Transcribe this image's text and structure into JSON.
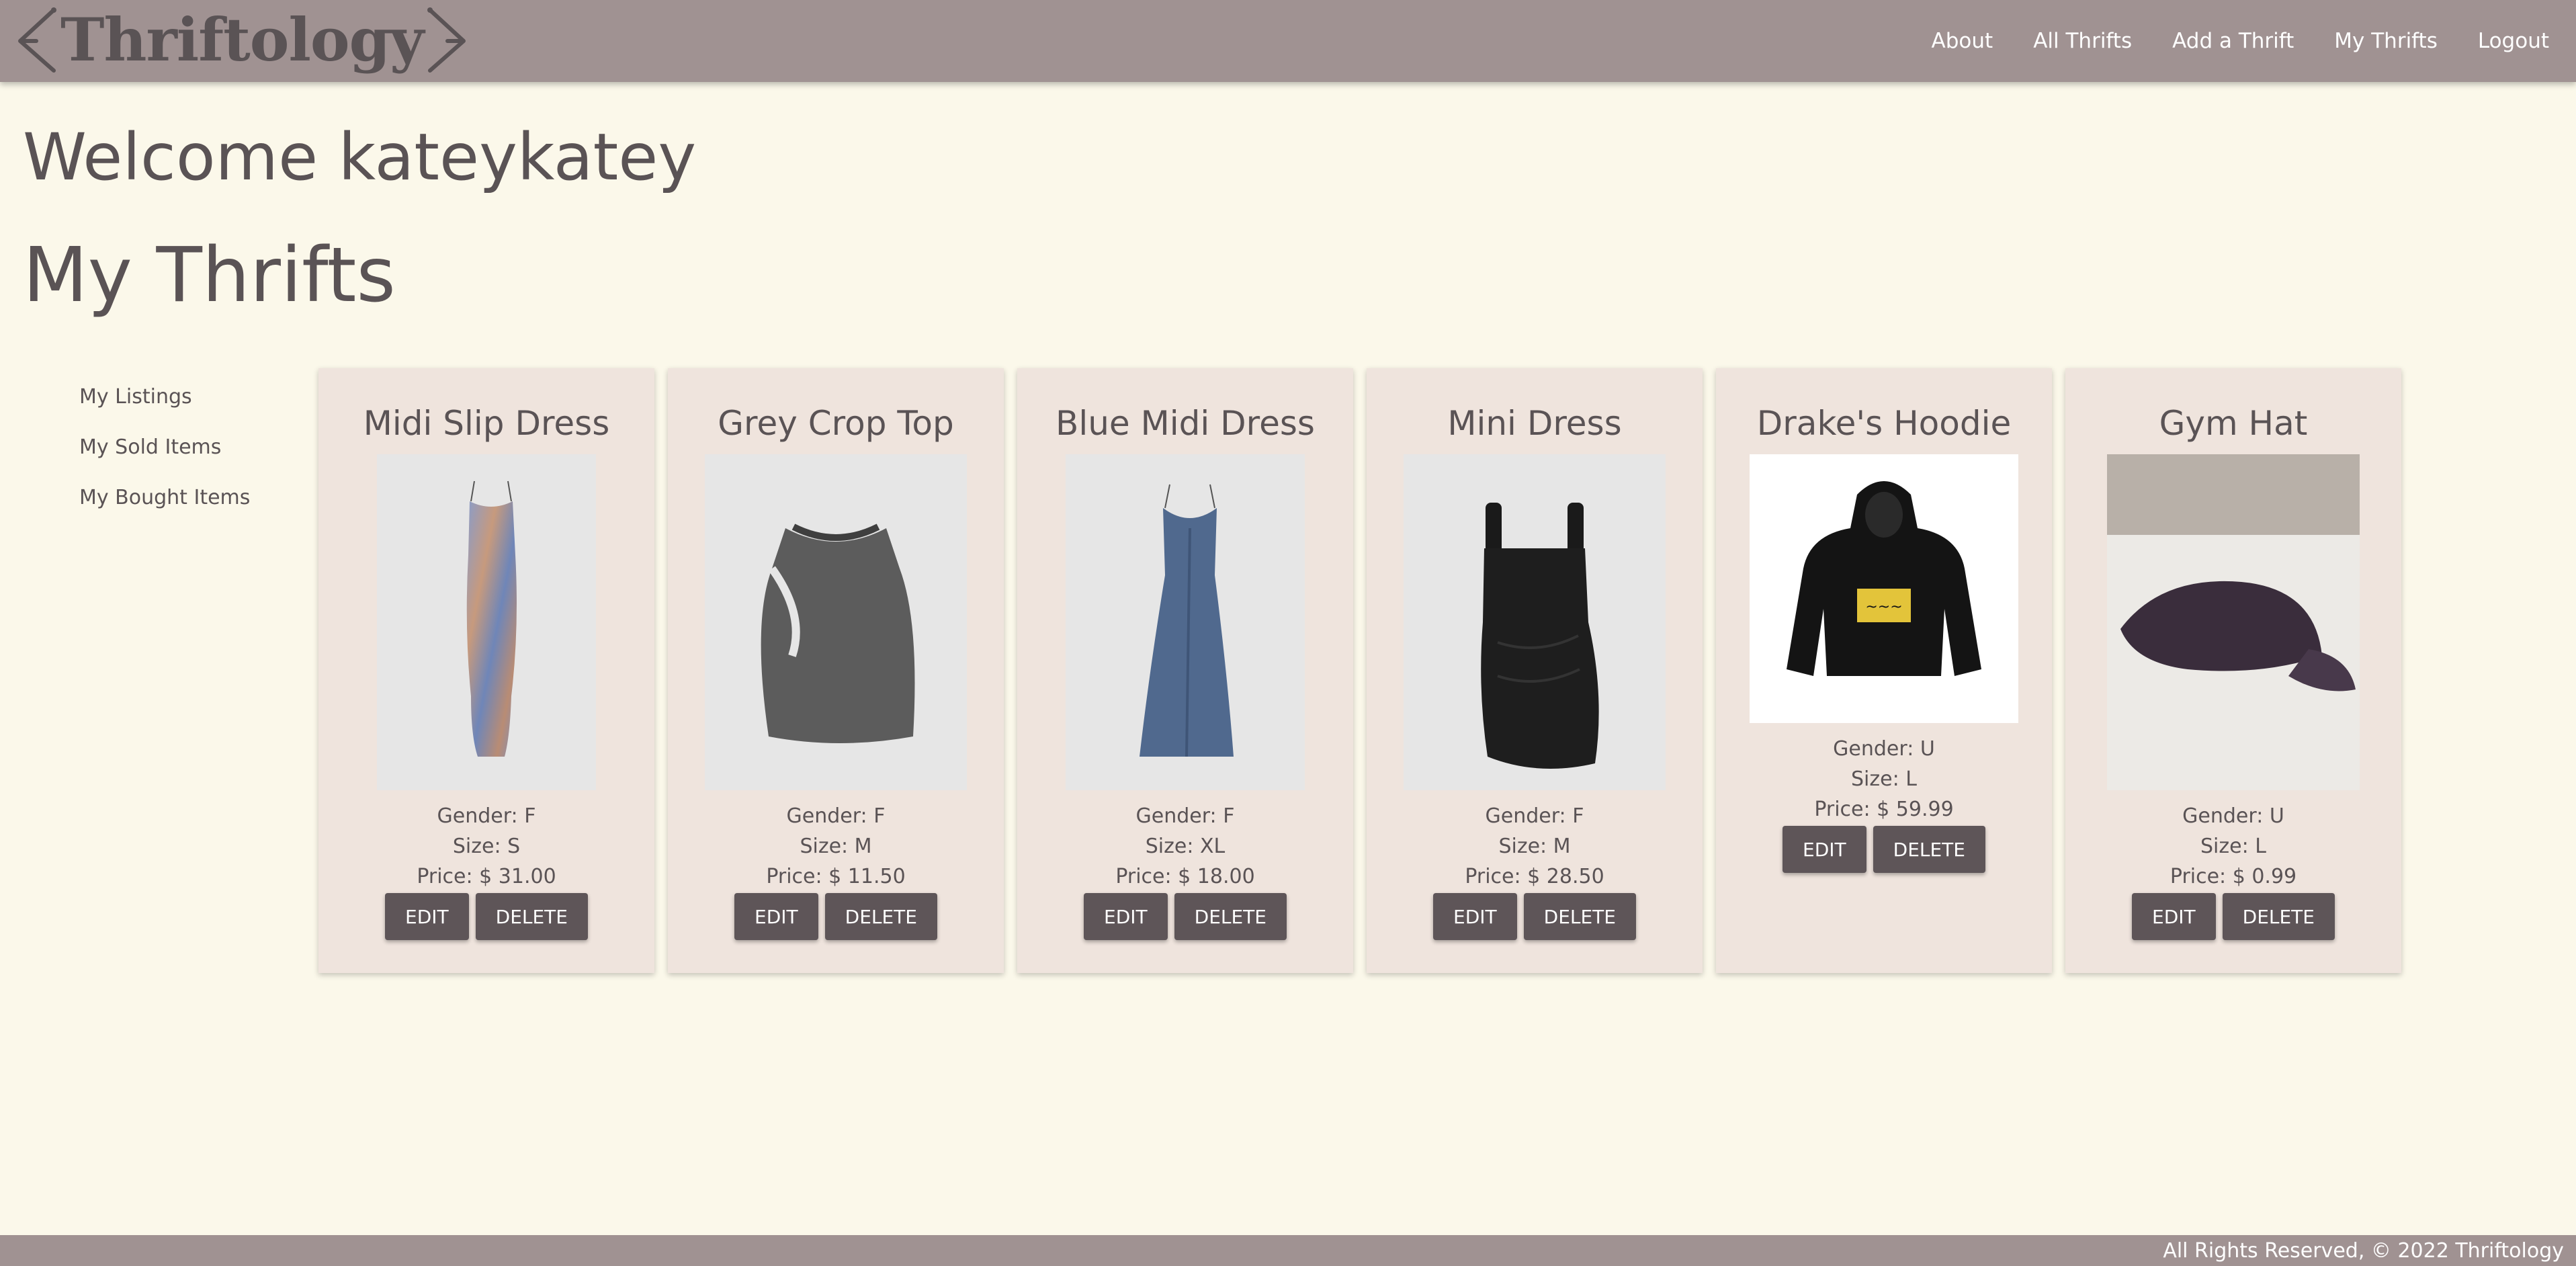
{
  "header": {
    "logo": "Thriftology",
    "nav": [
      "About",
      "All Thrifts",
      "Add a Thrift",
      "My Thrifts",
      "Logout"
    ]
  },
  "welcome": "Welcome kateykatey",
  "page_title": "My Thrifts",
  "sidebar": {
    "items": [
      "My Listings",
      "My Sold Items",
      "My Bought Items"
    ]
  },
  "cards": [
    {
      "title": "Midi Slip Dress",
      "gender": "Gender: F",
      "size": "Size: S",
      "price": "Price: $ 31.00",
      "edit": "EDIT",
      "delete": "DELETE",
      "image": "midi-slip-dress-photo"
    },
    {
      "title": "Grey Crop Top",
      "gender": "Gender: F",
      "size": "Size: M",
      "price": "Price: $ 11.50",
      "edit": "EDIT",
      "delete": "DELETE",
      "image": "grey-crop-top-photo"
    },
    {
      "title": "Blue Midi Dress",
      "gender": "Gender: F",
      "size": "Size: XL",
      "price": "Price: $ 18.00",
      "edit": "EDIT",
      "delete": "DELETE",
      "image": "blue-midi-dress-photo"
    },
    {
      "title": "Mini Dress",
      "gender": "Gender: F",
      "size": "Size: M",
      "price": "Price: $ 28.50",
      "edit": "EDIT",
      "delete": "DELETE",
      "image": "mini-dress-photo"
    },
    {
      "title": "Drake's Hoodie",
      "gender": "Gender: U",
      "size": "Size: L",
      "price": "Price: $ 59.99",
      "edit": "EDIT",
      "delete": "DELETE",
      "image": "hoodie-photo"
    },
    {
      "title": "Gym Hat",
      "gender": "Gender: U",
      "size": "Size: L",
      "price": "Price: $ 0.99",
      "edit": "EDIT",
      "delete": "DELETE",
      "image": "cap-photo"
    }
  ],
  "footer": "All Rights Reserved, © 2022 Thriftology",
  "colors": {
    "background": "#fbf8ea",
    "header": "#a09292",
    "card": "#efe4dd",
    "button": "#5e5558",
    "text": "#5a5355"
  }
}
